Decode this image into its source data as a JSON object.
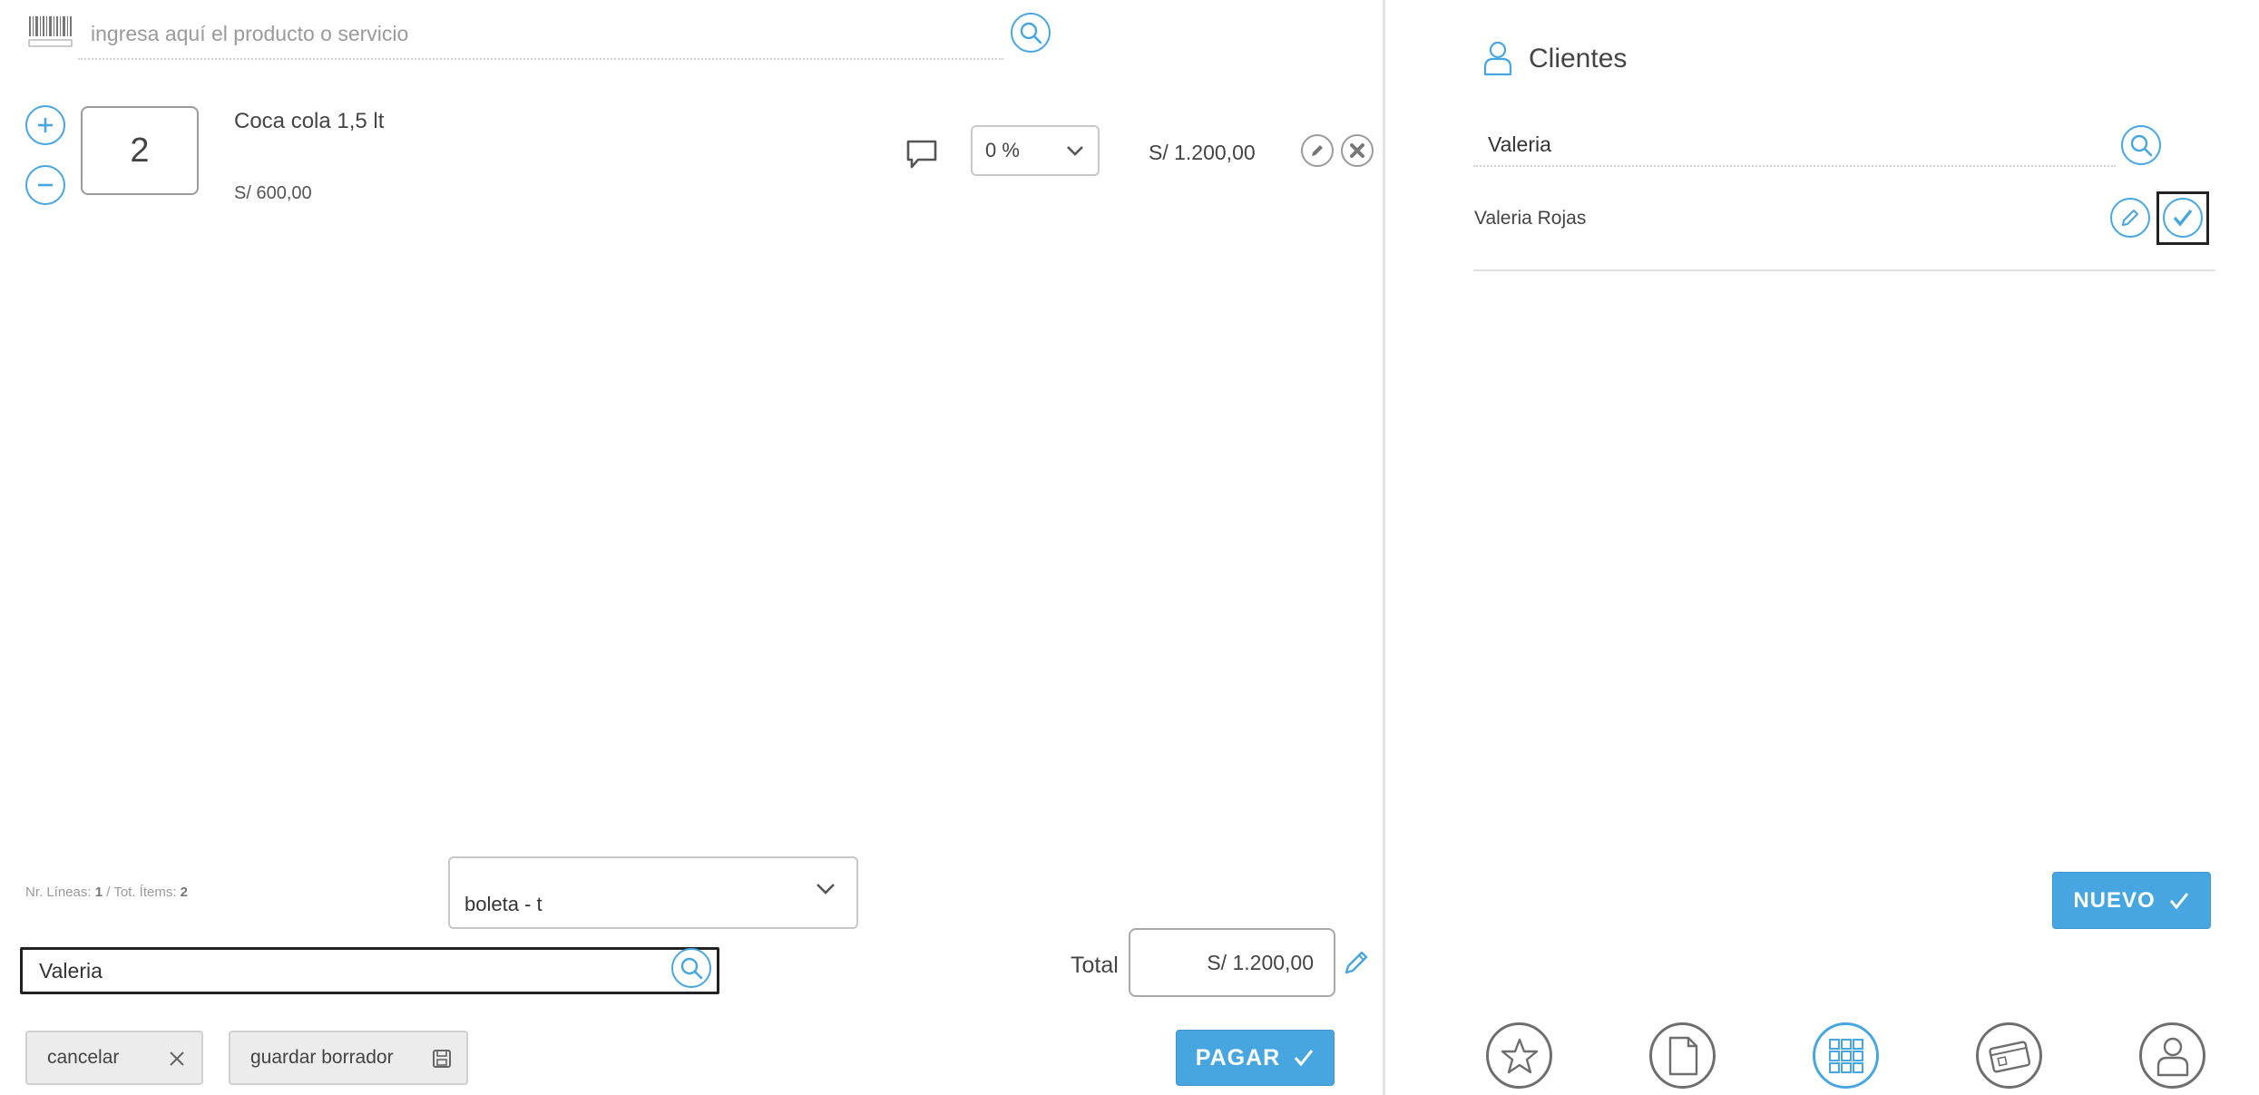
{
  "order": {
    "search_placeholder": "ingresa aquí el producto o servicio",
    "item": {
      "quantity": "2",
      "name": "Coca cola 1,5 lt",
      "unit_price": "S/ 600,00",
      "discount": "0 %",
      "line_total": "S/ 1.200,00"
    },
    "footer": {
      "lines_label": "Nr. Líneas:",
      "lines_value": "1",
      "separator": "/",
      "items_label": "Tot. Ítems:",
      "items_value": "2"
    },
    "document_type": "boleta - t",
    "client_value": "Valeria",
    "total_label": "Total",
    "total_value": "S/ 1.200,00",
    "cancel_label": "cancelar",
    "draft_label": "guardar borrador",
    "pay_label": "PAGAR"
  },
  "clients": {
    "title": "Clientes",
    "search_value": "Valeria",
    "results": [
      {
        "name": "Valeria Rojas"
      }
    ],
    "new_label": "NUEVO"
  },
  "nav": {
    "items": [
      {
        "icon": "star-icon"
      },
      {
        "icon": "document-icon"
      },
      {
        "icon": "grid-icon",
        "active": true
      },
      {
        "icon": "gift-card-icon"
      },
      {
        "icon": "user-icon"
      }
    ]
  },
  "colors": {
    "accent": "#47a6df",
    "border_gray": "#c8c8c8",
    "button_gray": "#ececec",
    "text": "#444444"
  }
}
